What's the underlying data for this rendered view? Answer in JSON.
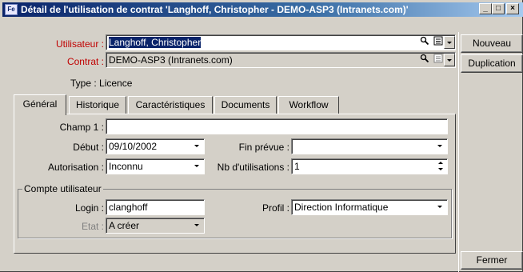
{
  "window": {
    "title": "Détail de l'utilisation de contrat 'Langhoff, Christopher - DEMO-ASP3 (Intranets.com)'",
    "controls": {
      "minimize": "_",
      "maximize": "□",
      "close": "×"
    }
  },
  "header": {
    "utilisateur_label": "Utilisateur :",
    "utilisateur_value": "Langhoff, Christopher",
    "contrat_label": "Contrat :",
    "contrat_value": "DEMO-ASP3 (Intranets.com)",
    "type_text": "Type : Licence"
  },
  "side_buttons": {
    "nouveau": "Nouveau",
    "duplication": "Duplication",
    "fermer": "Fermer"
  },
  "tabs": [
    {
      "label": "Général",
      "active": true
    },
    {
      "label": "Historique",
      "active": false
    },
    {
      "label": "Caractéristiques",
      "active": false
    },
    {
      "label": "Documents",
      "active": false
    },
    {
      "label": "Workflow",
      "active": false
    }
  ],
  "general": {
    "champ1_label": "Champ 1 :",
    "champ1_value": "",
    "debut_label": "Début :",
    "debut_value": "09/10/2002",
    "fin_label": "Fin prévue :",
    "fin_value": "",
    "autorisation_label": "Autorisation :",
    "autorisation_value": "Inconnu",
    "nb_label": "Nb d'utilisations :",
    "nb_value": "1"
  },
  "compte": {
    "legend": "Compte utilisateur",
    "login_label": "Login :",
    "login_value": "clanghoff",
    "profil_label": "Profil :",
    "profil_value": "Direction Informatique",
    "etat_label": "Etat :",
    "etat_value": "A créer"
  },
  "icons": {
    "search": "search-icon",
    "details": "details-icon",
    "dropdown": "dropdown-arrow-icon"
  }
}
